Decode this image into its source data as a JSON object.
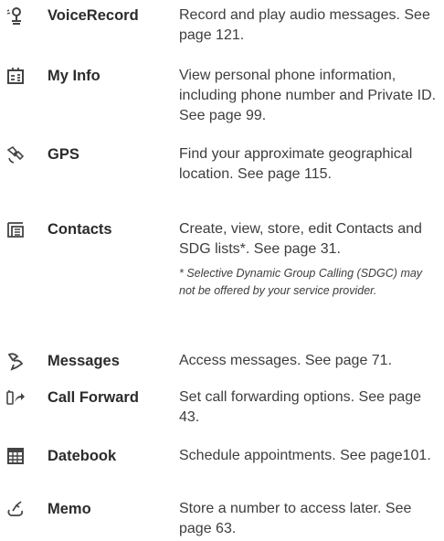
{
  "features": [
    {
      "icon": "microphone-icon",
      "name": "VoiceRecord",
      "description": "Record and play audio messages. See page 121."
    },
    {
      "icon": "my-info-icon",
      "name": "My Info",
      "description": "View personal phone information, including phone number and Private ID. See page 99."
    },
    {
      "icon": "satellite-icon",
      "name": "GPS",
      "description": "Find your approximate geographical location. See page 115."
    },
    {
      "icon": "contacts-icon",
      "name": "Contacts",
      "description": "Create, view, store, edit Contacts and SDG lists*. See page 31.",
      "note": "* Selective Dynamic Group Calling (SDGC) may not be offered by your service provider."
    },
    {
      "icon": "messages-icon",
      "name": "Messages",
      "description": "Access messages. See page 71."
    },
    {
      "icon": "call-forward-icon",
      "name": "Call Forward",
      "description": "Set call forwarding options. See page 43."
    },
    {
      "icon": "datebook-icon",
      "name": "Datebook",
      "description": "Schedule appointments. See page101."
    },
    {
      "icon": "memo-icon",
      "name": "Memo",
      "description": "Store a number to access later. See page 63."
    }
  ]
}
